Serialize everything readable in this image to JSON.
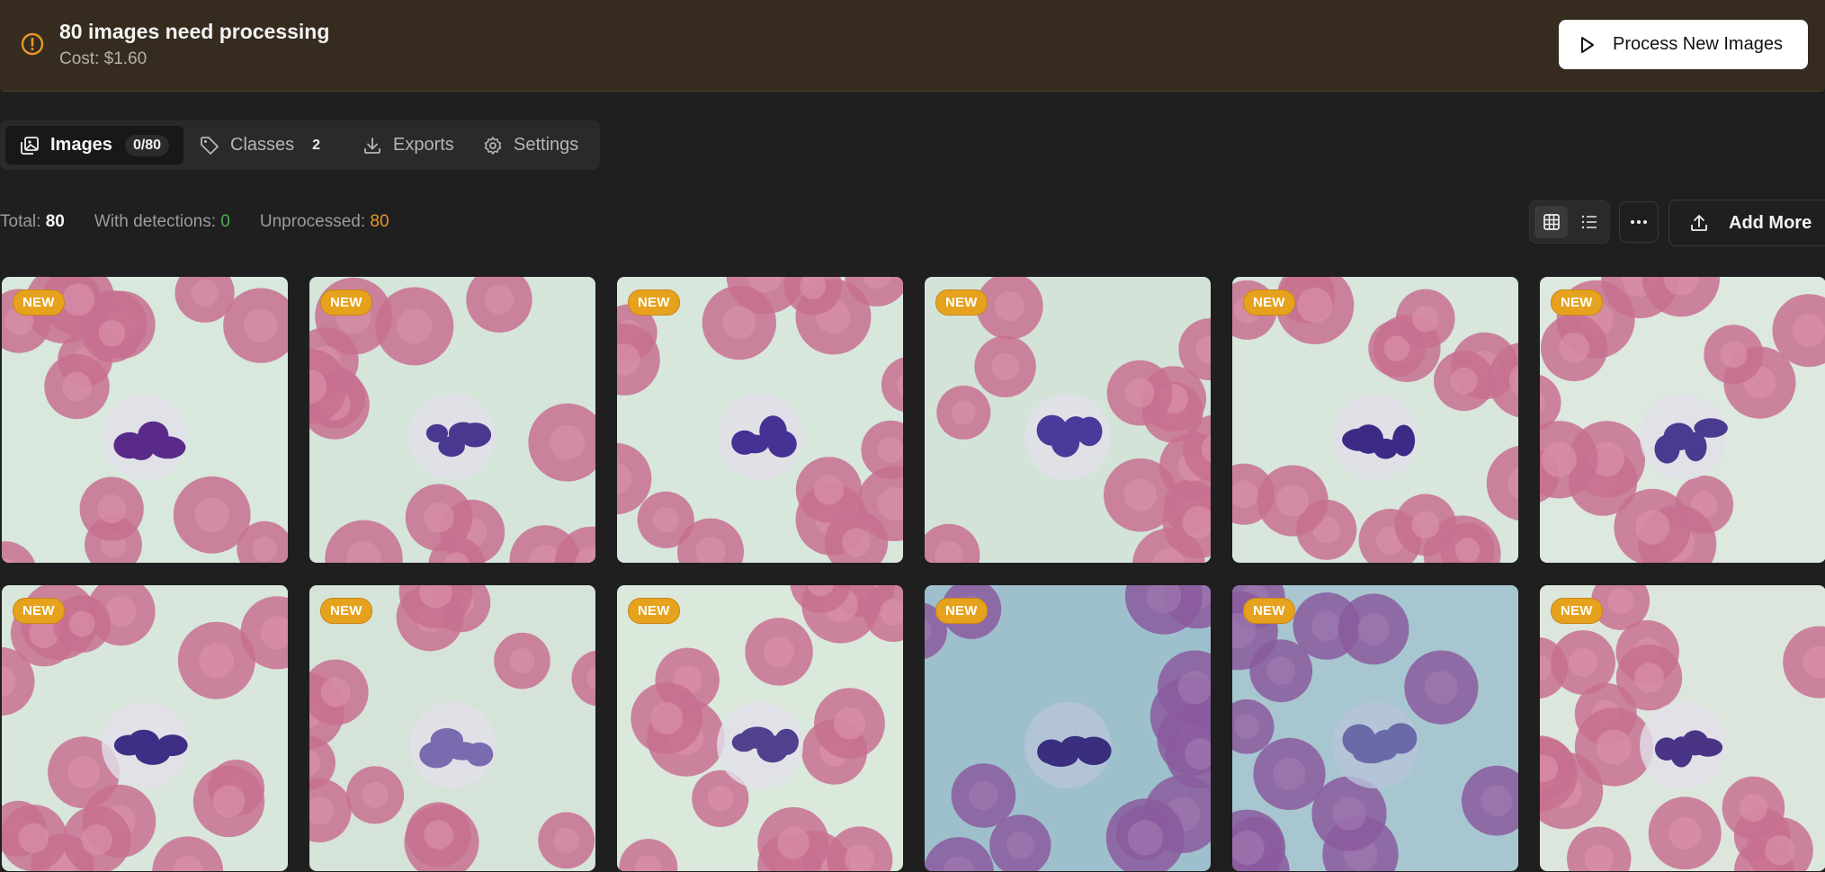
{
  "banner": {
    "title": "80 images need processing",
    "cost": "Cost: $1.60",
    "button_label": "Process New Images",
    "accent": "#e8962a"
  },
  "tabs": [
    {
      "label": "Images",
      "count": "0/80",
      "icon": "images-icon"
    },
    {
      "label": "Classes",
      "count": "2",
      "icon": "tag-icon"
    },
    {
      "label": "Exports",
      "icon": "download-icon"
    },
    {
      "label": "Settings",
      "icon": "gear-icon"
    }
  ],
  "stats": {
    "total_label": "Total:",
    "total": "80",
    "detections_label": "With detections:",
    "detections": "0",
    "unprocessed_label": "Unprocessed:",
    "unprocessed": "80"
  },
  "toolbar": {
    "add_label": "Add More",
    "view_mode": "grid"
  },
  "images": [
    {
      "badge": "NEW",
      "bg": "#d8e8dc",
      "cell": "#5a2a8a"
    },
    {
      "badge": "NEW",
      "bg": "#d5e5da",
      "cell": "#4a3890"
    },
    {
      "badge": "NEW",
      "bg": "#d8e7dc",
      "cell": "#463294"
    },
    {
      "badge": "NEW",
      "bg": "#d3e3d8",
      "cell": "#4a3a9a"
    },
    {
      "badge": "NEW",
      "bg": "#d8e6dc",
      "cell": "#3c2a86"
    },
    {
      "badge": "NEW",
      "bg": "#dde8de",
      "cell": "#4a3a90"
    },
    {
      "badge": "NEW",
      "bg": "#d9e6dc",
      "cell": "#3e2e86"
    },
    {
      "badge": "NEW",
      "bg": "#d6e3d8",
      "cell": "#7a6ab0"
    },
    {
      "badge": "NEW",
      "bg": "#dbe8dc",
      "cell": "#51408e"
    },
    {
      "badge": "NEW",
      "bg": "#9ec0cc",
      "cell": "#3a2f7e"
    },
    {
      "badge": "NEW",
      "bg": "#a8c6d0",
      "cell": "#6a6aa8"
    },
    {
      "badge": "NEW",
      "bg": "#dde6dc",
      "cell": "#4a3486"
    }
  ]
}
